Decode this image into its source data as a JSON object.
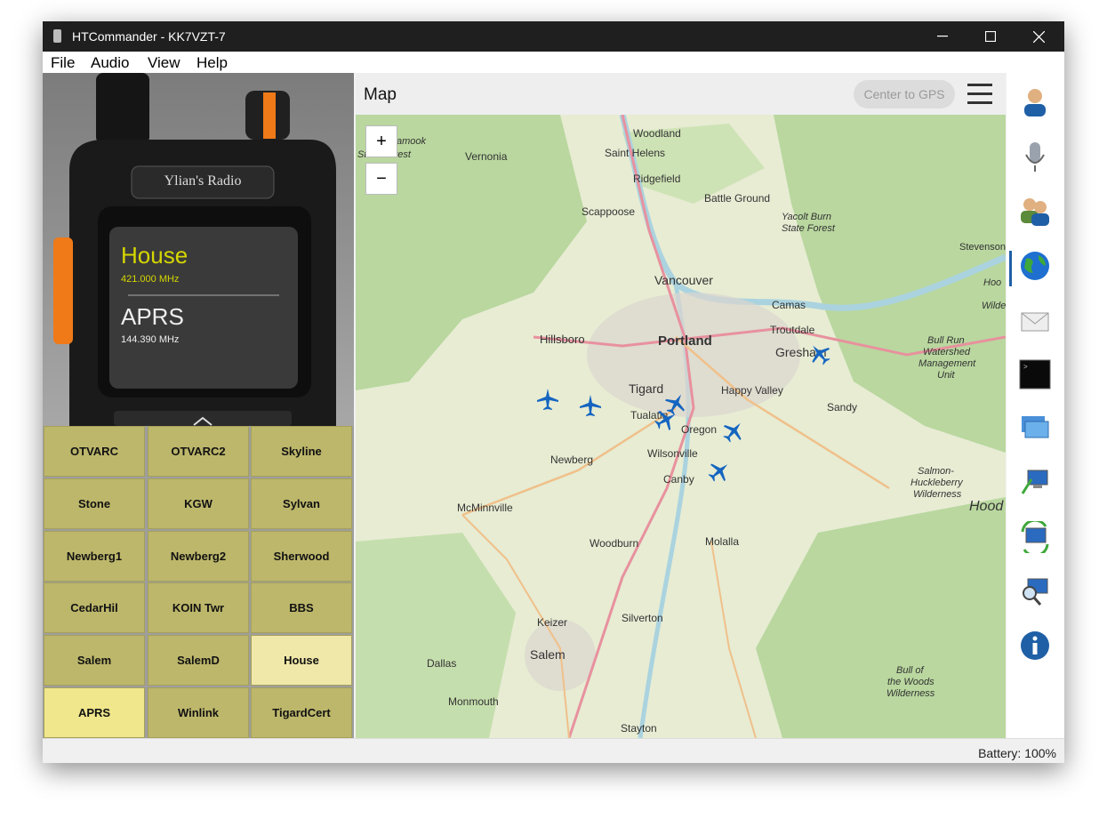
{
  "window": {
    "title": "HTCommander - KK7VZT-7"
  },
  "menu": [
    "File",
    "Audio",
    "View",
    "Help"
  ],
  "radio": {
    "name_label": "Ylian's Radio",
    "vfo_a": {
      "name": "House",
      "freq": "421.000 MHz"
    },
    "vfo_b": {
      "name": "APRS",
      "freq": "144.390 MHz"
    }
  },
  "channels": [
    "OTVARC",
    "OTVARC2",
    "Skyline",
    "Stone",
    "KGW",
    "Sylvan",
    "Newberg1",
    "Newberg2",
    "Sherwood",
    "CedarHil",
    "KOIN Twr",
    "BBS",
    "Salem",
    "SalemD",
    "House",
    "APRS",
    "Winlink",
    "TigardCert"
  ],
  "map": {
    "title": "Map",
    "center_gps": "Center to GPS",
    "zoom_in": "+",
    "zoom_out": "−",
    "cities": [
      "Woodland",
      "Saint Helens",
      "Vernonia",
      "Ridgefield",
      "Battle Ground",
      "Scappoose",
      "Yacolt Burn",
      "State Forest",
      "Stevenson",
      "Vancouver",
      "Camas",
      "Hillsboro",
      "Portland",
      "Troutdale",
      "Gresham",
      "Bull Run",
      "Watershed",
      "Management",
      "Unit",
      "Tigard",
      "Happy Valley",
      "Tualatin",
      "Oregon",
      "Sandy",
      "Newberg",
      "Wilsonville",
      "Canby",
      "Salmon-",
      "Huckleberry",
      "Wilderness",
      "Hood",
      "McMinnville",
      "Molalla",
      "Woodburn",
      "Silverton",
      "Keizer",
      "Salem",
      "Dallas",
      "Bull of",
      "the Woods",
      "Wilderness",
      "Monmouth",
      "Stayton",
      "Tillamook",
      "State Forest",
      "Hoo",
      "Wilde"
    ]
  },
  "sidebar_icons": [
    "contacts-icon",
    "microphone-icon",
    "users-icon",
    "globe-icon",
    "mail-icon",
    "terminal-icon",
    "windows-icon",
    "network-icon",
    "sync-icon",
    "search-computer-icon",
    "info-icon"
  ],
  "status": {
    "battery": "Battery: 100%"
  },
  "colors": {
    "titlebar": "#1f1f1f",
    "channel": "#bdb76b",
    "channel_selected": "#f0e68c",
    "accent": "#1565c0"
  }
}
